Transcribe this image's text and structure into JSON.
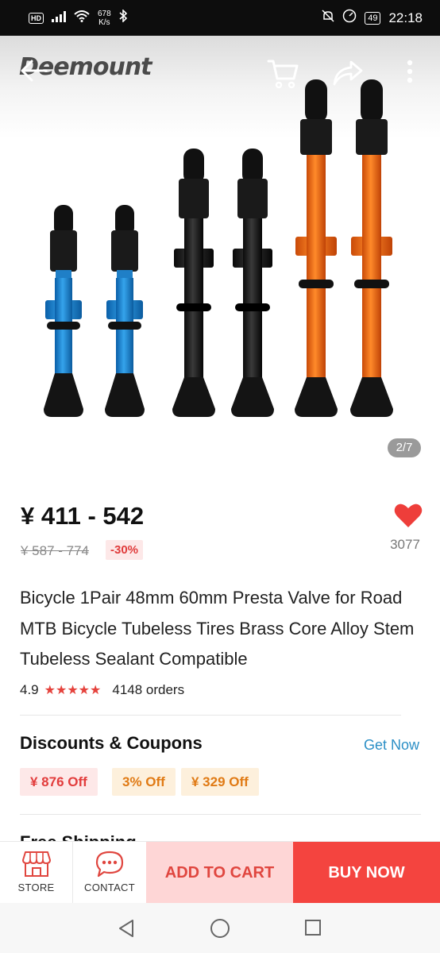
{
  "status_bar": {
    "hd": "HD",
    "net_speed_top": "678",
    "net_speed_bottom": "K/s",
    "battery": "49",
    "time": "22:18"
  },
  "header": {
    "brand": "Deemount",
    "image_counter": "2/7"
  },
  "product": {
    "price": "¥ 411 - 542",
    "original_price": "¥ 587 - 774",
    "discount": "-30%",
    "wishlist_count": "3077",
    "title": "Bicycle 1Pair 48mm 60mm Presta Valve for Road MTB Bicycle Tubeless Tires Brass Core Alloy Stem Tubeless Sealant Compatible",
    "rating": "4.9",
    "stars": "★★★★★",
    "orders": "4148 orders"
  },
  "discounts": {
    "title": "Discounts & Coupons",
    "get_now": "Get Now",
    "coupons": [
      "¥ 876 Off",
      "3% Off",
      "¥ 329 Off"
    ]
  },
  "next_section_peek": "Free Shipping",
  "action_bar": {
    "store_label": "STORE",
    "contact_label": "CONTACT",
    "add_to_cart": "ADD TO CART",
    "buy_now": "BUY NOW"
  },
  "colors": {
    "accent_red": "#f4443f",
    "cart_pink": "#fed6d6",
    "link_blue": "#2b8fc6",
    "coupon_orange": "#e07a14"
  }
}
